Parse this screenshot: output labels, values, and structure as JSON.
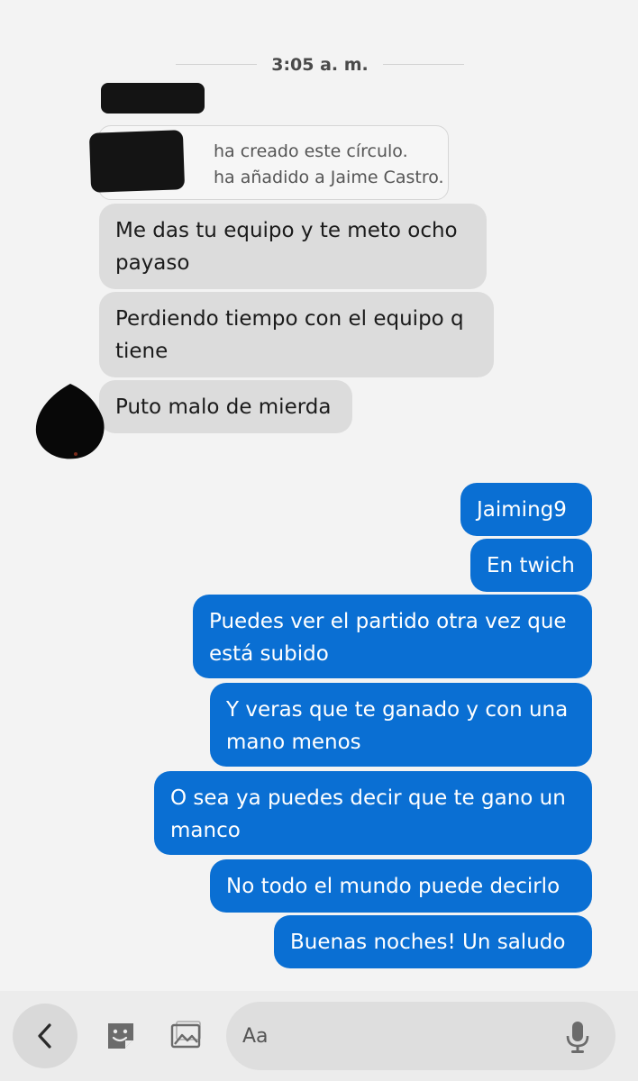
{
  "timestamp": "3:05 a. m.",
  "system_messages": [
    "ha creado este círculo.",
    "ha añadido a Jaime Castro."
  ],
  "incoming_messages": [
    "Me das tu equipo y te meto ocho payaso",
    "Perdiendo tiempo con el equipo q tiene",
    "Puto malo de mierda"
  ],
  "outgoing_messages": [
    "Jaiming9",
    "En twich",
    "Puedes ver el partido otra vez que está subido",
    "Y veras que te ganado y con una mano menos",
    "O sea ya puedes decir que te gano un manco",
    "No todo el mundo puede decirlo",
    "Buenas noches! Un saludo"
  ],
  "composer": {
    "placeholder": "Aa",
    "icons": [
      "back-arrow-icon",
      "sticker-icon",
      "image-icon",
      "microphone-icon"
    ]
  },
  "colors": {
    "background": "#f3f3f3",
    "incoming_bubble": "#dcdcdc",
    "outgoing_bubble": "#0a6fd3",
    "outgoing_text": "#ffffff"
  }
}
